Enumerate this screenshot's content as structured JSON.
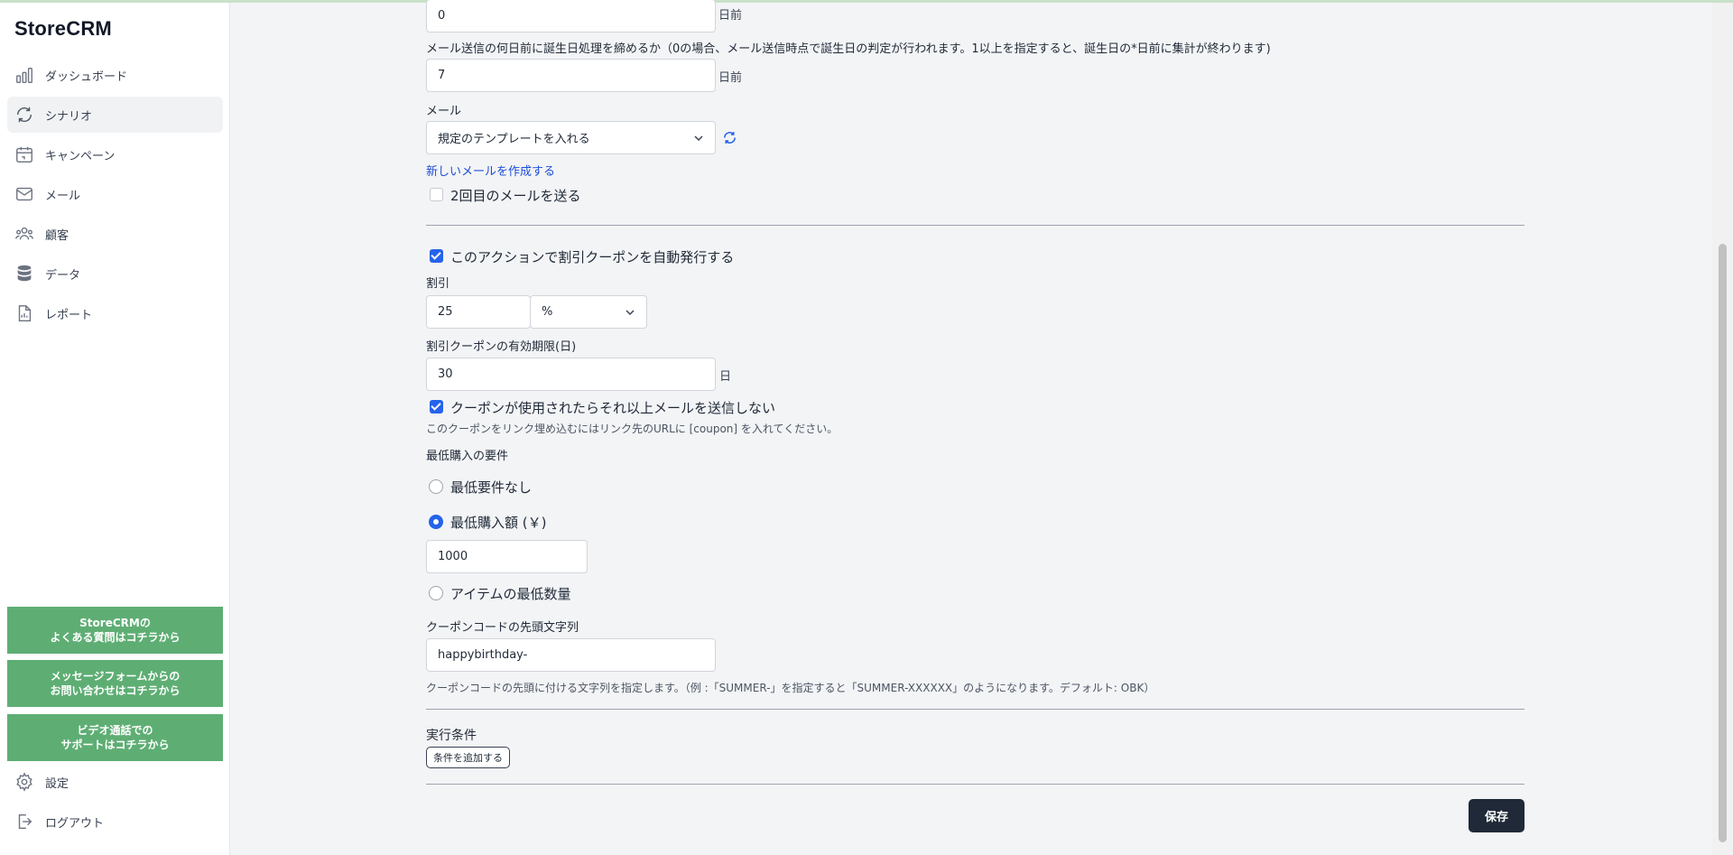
{
  "brand": "StoreCRM",
  "nav": [
    {
      "label": "ダッシュボード",
      "icon": "chart-bars-icon"
    },
    {
      "label": "シナリオ",
      "icon": "refresh-cycle-icon",
      "active": true
    },
    {
      "label": "キャンペーン",
      "icon": "calendar-icon"
    },
    {
      "label": "メール",
      "icon": "mail-icon"
    },
    {
      "label": "顧客",
      "icon": "users-icon"
    },
    {
      "label": "データ",
      "icon": "database-icon"
    },
    {
      "label": "レポート",
      "icon": "document-icon"
    }
  ],
  "help_links": [
    {
      "line1": "StoreCRMの",
      "line2": "よくある質問はコチラから"
    },
    {
      "line1": "メッセージフォームからの",
      "line2": "お問い合わせはコチラから"
    },
    {
      "line1": "ビデオ通話での",
      "line2": "サポートはコチラから"
    }
  ],
  "settings_label": "設定",
  "logout_label": "ログアウト",
  "form": {
    "days_before_value": "0",
    "days_before_suffix": "日前",
    "cutoff_label": "メール送信の何日前に誕生日処理を締めるか（0の場合、メール送信時点で誕生日の判定が行われます。1以上を指定すると、誕生日の*日前に集計が終わります)",
    "cutoff_value": "7",
    "cutoff_suffix": "日前",
    "mail_label": "メール",
    "mail_select": "規定のテンプレートを入れる",
    "new_mail_link": "新しいメールを作成する",
    "second_mail_label": "2回目のメールを送る",
    "second_mail_checked": false,
    "auto_coupon_label": "このアクションで割引クーポンを自動発行する",
    "auto_coupon_checked": true,
    "discount_label": "割引",
    "discount_value": "25",
    "discount_unit": "%",
    "expiry_label": "割引クーポンの有効期限(日)",
    "expiry_value": "30",
    "expiry_suffix": "日",
    "stop_mail_label": "クーポンが使用されたらそれ以上メールを送信しない",
    "stop_mail_checked": true,
    "coupon_hint": "このクーポンをリンク埋め込むにはリンク先のURLに [coupon] を入れてください。",
    "min_req_label": "最低購入の要件",
    "req_none_label": "最低要件なし",
    "req_amount_label": "最低購入額 (￥)",
    "req_amount_value": "1000",
    "req_qty_label": "アイテムの最低数量",
    "selected_requirement": "amount",
    "prefix_label": "クーポンコードの先頭文字列",
    "prefix_value": "happybirthday-",
    "prefix_hint": "クーポンコードの先頭に付ける文字列を指定します。（例 :「SUMMER-」を指定すると「SUMMER-XXXXXX」のようになります。デフォルト: OBK）",
    "conditions_label": "実行条件",
    "add_condition_button": "条件を追加する",
    "save_button": "保存"
  },
  "colors": {
    "accent": "#2563eb",
    "help_green": "#5eae74",
    "save_dark": "#1f2937",
    "link_blue": "#1d4ed8"
  }
}
